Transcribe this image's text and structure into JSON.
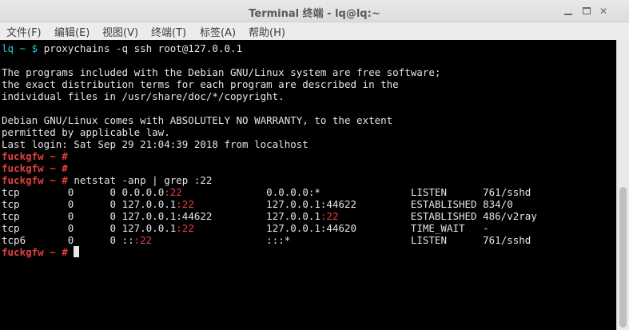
{
  "window": {
    "title": "Terminal 终端 - lq@lq:~",
    "min_symbol": "—",
    "close_symbol": "✕"
  },
  "menu": [
    {
      "label": "文件(F)"
    },
    {
      "label": "编辑(E)"
    },
    {
      "label": "视图(V)"
    },
    {
      "label": "终端(T)"
    },
    {
      "label": "标签(A)"
    },
    {
      "label": "帮助(H)"
    }
  ],
  "terminal": {
    "user_prompt": "lq ~ $ ",
    "ssh_command": "proxychains -q ssh root@127.0.0.1",
    "motd": [
      "The programs included with the Debian GNU/Linux system are free software;",
      "the exact distribution terms for each program are described in the",
      "individual files in /usr/share/doc/*/copyright.",
      "",
      "Debian GNU/Linux comes with ABSOLUTELY NO WARRANTY, to the extent",
      "permitted by applicable law.",
      "Last login: Sat Sep 29 21:04:39 2018 from localhost"
    ],
    "root_prompt_host": "fuckgfw",
    "root_prompt_suffix": " ~ # ",
    "netstat_command": "netstat -anp | grep :22",
    "netstat_rows": [
      {
        "proto": "tcp ",
        "recvq": "0",
        "sendq": "0",
        "local_ip": "0.0.0.0",
        "local_port": ":22",
        "local_hl": true,
        "foreign_ip": "0.0.0.0",
        "foreign_port": ":*",
        "foreign_hl": false,
        "state": "LISTEN",
        "program": "761/sshd"
      },
      {
        "proto": "tcp ",
        "recvq": "0",
        "sendq": "0",
        "local_ip": "127.0.0.1",
        "local_port": ":22",
        "local_hl": true,
        "foreign_ip": "127.0.0.1",
        "foreign_port": ":44622",
        "foreign_hl": false,
        "state": "ESTABLISHED",
        "program": "834/0"
      },
      {
        "proto": "tcp ",
        "recvq": "0",
        "sendq": "0",
        "local_ip": "127.0.0.1",
        "local_port": ":44622",
        "local_hl": false,
        "foreign_ip": "127.0.0.1",
        "foreign_port": ":22",
        "foreign_hl": true,
        "state": "ESTABLISHED",
        "program": "486/v2ray"
      },
      {
        "proto": "tcp ",
        "recvq": "0",
        "sendq": "0",
        "local_ip": "127.0.0.1",
        "local_port": ":22",
        "local_hl": true,
        "foreign_ip": "127.0.0.1",
        "foreign_port": ":44620",
        "foreign_hl": false,
        "state": "TIME_WAIT",
        "program": "-"
      },
      {
        "proto": "tcp6",
        "recvq": "0",
        "sendq": "0",
        "local_ip": "::",
        "local_port": ":22",
        "local_hl": true,
        "foreign_ip": ":::",
        "foreign_port": "*",
        "foreign_hl": false,
        "state": "LISTEN",
        "program": "761/sshd"
      }
    ]
  },
  "colors": {
    "terminal_bg": "#000000",
    "text": "#e5e5e5",
    "user_prompt": "#27c5df",
    "root_prompt": "#e2403f",
    "port_highlight": "#e2403f"
  }
}
